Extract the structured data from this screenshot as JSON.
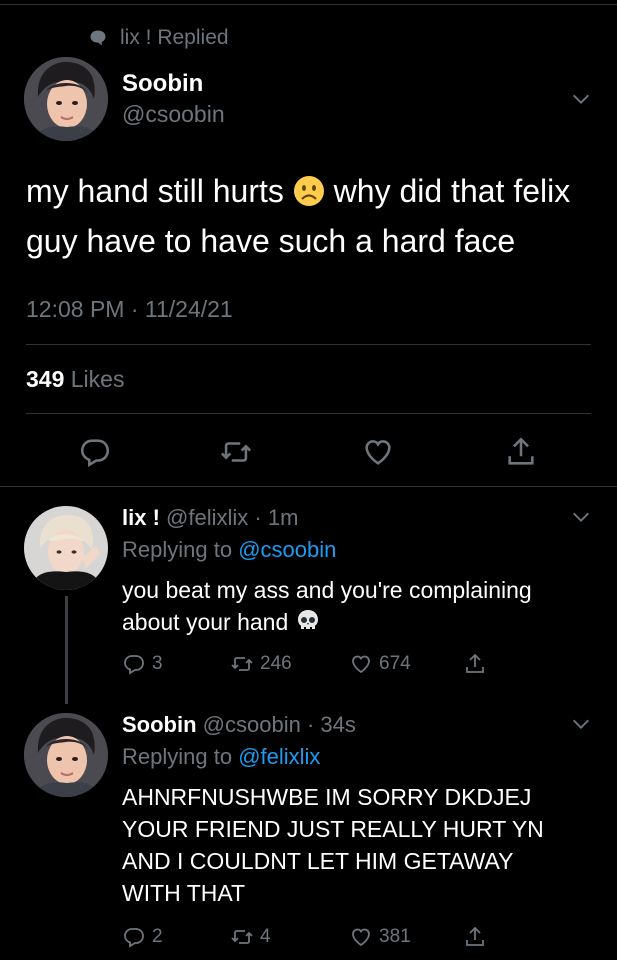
{
  "context": {
    "text": "lix ! Replied",
    "icon": "speech-bubble-icon"
  },
  "main_tweet": {
    "name": "Soobin",
    "handle": "@csoobin",
    "text_part1": "my hand still hurts",
    "emoji": "frowning-face-emoji",
    "text_part2": "why did that felix guy have to have such a hard face",
    "timestamp": "12:08 PM · 11/24/21",
    "likes_count": "349",
    "likes_label": "Likes"
  },
  "reply1": {
    "name": "lix !",
    "handle": "@felixlix",
    "time": "· 1m",
    "replying_label": "Replying to",
    "replying_to": "@csoobin",
    "text": "you beat my ass and you're complaining about your hand",
    "emoji": "skull-emoji",
    "replies": "3",
    "retweets": "246",
    "likes": "674"
  },
  "reply2": {
    "name": "Soobin",
    "handle": "@csoobin",
    "time": "· 34s",
    "replying_label": "Replying to",
    "replying_to": "@felixlix",
    "text": "AHNRFNUSHWBE IM SORRY DKDJEJ YOUR FRIEND JUST REALLY HURT YN AND I COULDNT LET HIM GETAWAY WITH THAT",
    "replies": "2",
    "retweets": "4",
    "likes": "381"
  },
  "colors": {
    "background": "#000000",
    "secondary_text": "#6e767d",
    "link": "#1d9bf0",
    "divider": "#2f3336"
  }
}
